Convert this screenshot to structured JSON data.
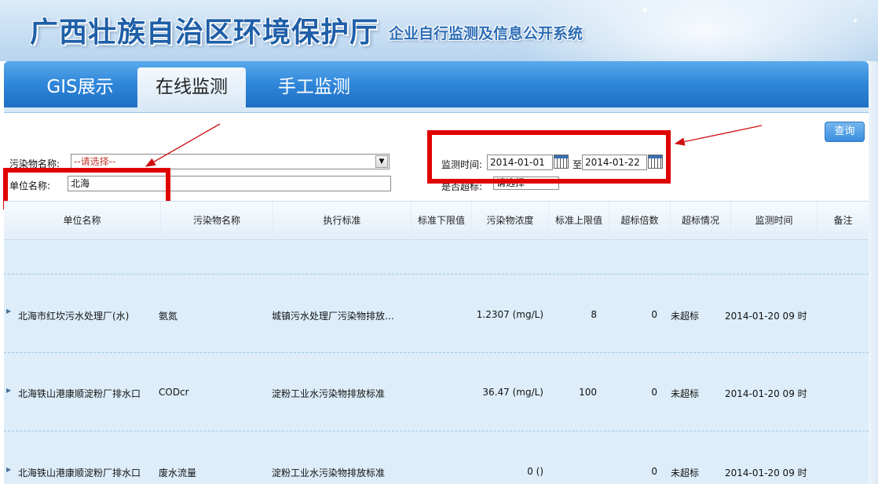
{
  "banner": {
    "title": "广西壮族自治区环境保护厅",
    "subtitle": "企业自行监测及信息公开系统"
  },
  "tabs": [
    {
      "label": "GIS展示",
      "active": false
    },
    {
      "label": "在线监测",
      "active": true
    },
    {
      "label": "手工监测",
      "active": false
    }
  ],
  "filters": {
    "query_button": "查询",
    "pollutant_label": "污染物名称:",
    "pollutant_value": "--请选择--",
    "unit_label": "单位名称:",
    "unit_value": "北海",
    "time_label": "监测时间:",
    "date_from": "2014-01-01",
    "to_label": "至",
    "date_to": "2014-01-22",
    "exceed_label": "是否超标:",
    "exceed_value": "请选择"
  },
  "table": {
    "headers": [
      "单位名称",
      "污染物名称",
      "执行标准",
      "标准下限值",
      "污染物浓度",
      "标准上限值",
      "超标倍数",
      "超标情况",
      "监测时间",
      "备注"
    ],
    "rows": [
      {
        "unit": "北海市红坎污水处理厂(水)",
        "pollutant": "氨氮",
        "standard": "城镇污水处理厂污染物排放…",
        "lower": "",
        "concentration": "1.2307 (mg/L)",
        "upper": "8",
        "exceed_times": "0",
        "exceed_status": "未超标",
        "time": "2014-01-20 09 时",
        "note": ""
      },
      {
        "unit": "北海铁山港康顺淀粉厂排水口",
        "pollutant": "CODcr",
        "standard": "淀粉工业水污染物排放标准",
        "lower": "",
        "concentration": "36.47 (mg/L)",
        "upper": "100",
        "exceed_times": "0",
        "exceed_status": "未超标",
        "time": "2014-01-20 09 时",
        "note": ""
      },
      {
        "unit": "北海铁山港康顺淀粉厂排水口",
        "pollutant": "废水流量",
        "standard": "淀粉工业水污染物排放标准",
        "lower": "",
        "concentration": "0 ()",
        "upper": "",
        "exceed_times": "0",
        "exceed_status": "未超标",
        "time": "2014-01-20 09 时",
        "note": ""
      }
    ]
  },
  "colors": {
    "tab_bar": "#2f86d9",
    "annotation": "#e00000",
    "table_body": "#ddeefa"
  }
}
